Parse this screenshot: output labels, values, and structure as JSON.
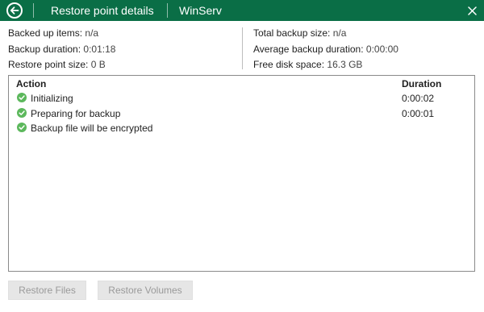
{
  "header": {
    "title": "Restore point details",
    "machine": "WinServ"
  },
  "stats": {
    "backed_up_items_label": "Backed up items:",
    "backed_up_items_value": "n/a",
    "backup_duration_label": "Backup duration:",
    "backup_duration_value": "0:01:18",
    "restore_point_size_label": "Restore point size:",
    "restore_point_size_value": "0 B",
    "total_backup_size_label": "Total backup size:",
    "total_backup_size_value": "n/a",
    "average_backup_duration_label": "Average backup duration:",
    "average_backup_duration_value": "0:00:00",
    "free_disk_space_label": "Free disk space:",
    "free_disk_space_value": "16.3 GB"
  },
  "table": {
    "columns": {
      "action": "Action",
      "duration": "Duration"
    },
    "rows": [
      {
        "action": "Initializing",
        "duration": "0:00:02",
        "status_icon": "check-circle-icon"
      },
      {
        "action": "Preparing for backup",
        "duration": "0:00:01",
        "status_icon": "check-circle-icon"
      },
      {
        "action": "Backup file will be encrypted",
        "duration": "",
        "status_icon": "check-circle-icon"
      }
    ]
  },
  "buttons": {
    "restore_files": "Restore Files",
    "restore_volumes": "Restore Volumes"
  },
  "colors": {
    "header_bg": "#0a6e46",
    "success_green": "#5cb85c",
    "disabled_button_bg": "#e6e6e6",
    "disabled_button_text": "#9a9a9a"
  }
}
